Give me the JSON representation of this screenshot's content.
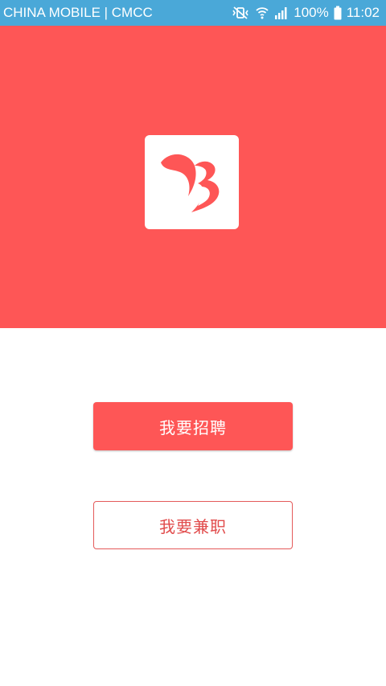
{
  "status_bar": {
    "carrier": "CHINA MOBILE | CMCC",
    "battery": "100%",
    "time": "11:02",
    "icons": [
      "mute-vibrate-icon",
      "wifi-icon",
      "signal-icon",
      "battery-icon"
    ]
  },
  "hero": {
    "logo_icon": "brand-b-logo-icon"
  },
  "actions": {
    "recruit_label": "我要招聘",
    "parttime_label": "我要兼职"
  },
  "colors": {
    "status_bar": "#4aa8d8",
    "brand_red": "#fe5656",
    "outline_text": "#e14c4c",
    "background": "#ffffff"
  }
}
